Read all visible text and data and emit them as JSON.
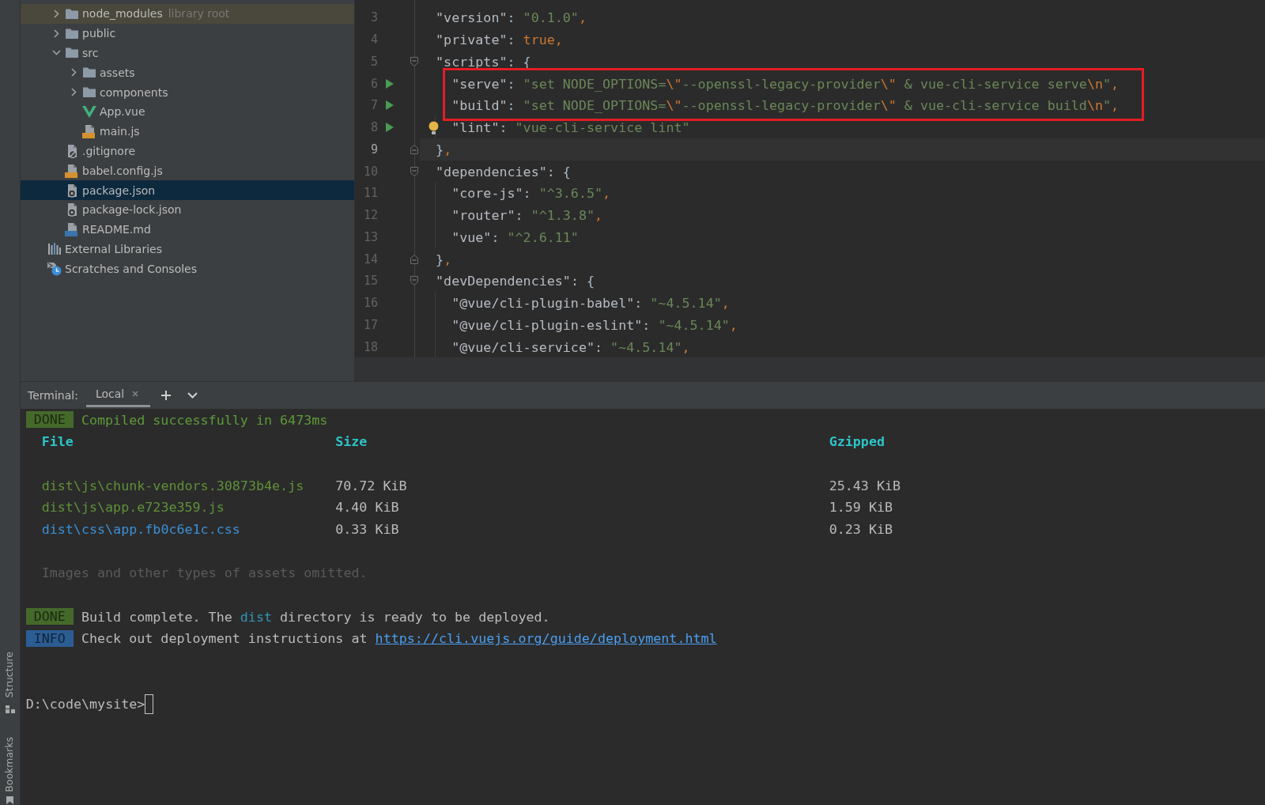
{
  "tool_strip": {
    "items": [
      {
        "kind": "structure",
        "label": "Structure"
      },
      {
        "kind": "bookmarks",
        "label": "Bookmarks"
      }
    ]
  },
  "project_tree": {
    "items": [
      {
        "kind": "folder",
        "label": "node_modules",
        "hint": "library root",
        "expanded": false,
        "selected": false,
        "library": true
      },
      {
        "kind": "folder",
        "label": "public",
        "expanded": false,
        "selected": false,
        "library": false
      },
      {
        "kind": "folder",
        "label": "src",
        "expanded": true,
        "selected": false,
        "library": false,
        "children": [
          {
            "kind": "folder",
            "label": "assets",
            "expanded": false,
            "selected": false,
            "library": false
          },
          {
            "kind": "folder",
            "label": "components",
            "expanded": false,
            "selected": false,
            "library": false
          },
          {
            "kind": "vue",
            "label": "App.vue",
            "selected": false,
            "library": false
          },
          {
            "kind": "js",
            "label": "main.js",
            "selected": false,
            "library": false
          }
        ]
      },
      {
        "kind": "ignore",
        "label": ".gitignore",
        "selected": false,
        "library": false
      },
      {
        "kind": "js",
        "label": "babel.config.js",
        "selected": false,
        "library": false
      },
      {
        "kind": "json",
        "label": "package.json",
        "selected": true,
        "library": false
      },
      {
        "kind": "json",
        "label": "package-lock.json",
        "selected": false,
        "library": false
      },
      {
        "kind": "markdown",
        "label": "README.md",
        "selected": false,
        "library": false
      }
    ],
    "top_items": [
      {
        "kind": "libraries",
        "label": "External Libraries",
        "selected": false
      },
      {
        "kind": "scratches",
        "label": "Scratches and Consoles",
        "selected": false
      }
    ]
  },
  "editor": {
    "lines": [
      {
        "number": "3",
        "text": "  \"version\": \"0.1.0\",",
        "current": false,
        "boxed": false,
        "runnable": false,
        "bulb": false,
        "fold_start": false,
        "fold_end": false
      },
      {
        "number": "4",
        "text": "  \"private\": true,",
        "current": false,
        "boxed": false,
        "runnable": false,
        "bulb": false,
        "fold_start": false,
        "fold_end": false
      },
      {
        "number": "5",
        "text": "  \"scripts\": {",
        "current": false,
        "boxed": false,
        "runnable": false,
        "bulb": false,
        "fold_start": true,
        "fold_end": false
      },
      {
        "number": "6",
        "text": "    \"serve\": \"set NODE_OPTIONS=\\\"--openssl-legacy-provider\\\" & vue-cli-service serve\\n\",",
        "current": false,
        "boxed": true,
        "runnable": true,
        "bulb": false,
        "fold_start": false,
        "fold_end": false
      },
      {
        "number": "7",
        "text": "    \"build\": \"set NODE_OPTIONS=\\\"--openssl-legacy-provider\\\" & vue-cli-service build\\n\",",
        "current": false,
        "boxed": true,
        "runnable": true,
        "bulb": false,
        "fold_start": false,
        "fold_end": false
      },
      {
        "number": "8",
        "text": "    \"lint\": \"vue-cli-service lint\"",
        "current": false,
        "boxed": false,
        "runnable": true,
        "bulb": true,
        "fold_start": false,
        "fold_end": false
      },
      {
        "number": "9",
        "text": "  },",
        "current": true,
        "boxed": false,
        "runnable": false,
        "bulb": false,
        "fold_start": false,
        "fold_end": true
      },
      {
        "number": "10",
        "text": "  \"dependencies\": {",
        "current": false,
        "boxed": false,
        "runnable": false,
        "bulb": false,
        "fold_start": true,
        "fold_end": false
      },
      {
        "number": "11",
        "text": "    \"core-js\": \"^3.6.5\",",
        "current": false,
        "boxed": false,
        "runnable": false,
        "bulb": false,
        "fold_start": false,
        "fold_end": false
      },
      {
        "number": "12",
        "text": "    \"router\": \"^1.3.8\",",
        "current": false,
        "boxed": false,
        "runnable": false,
        "bulb": false,
        "fold_start": false,
        "fold_end": false
      },
      {
        "number": "13",
        "text": "    \"vue\": \"^2.6.11\"",
        "current": false,
        "boxed": false,
        "runnable": false,
        "bulb": false,
        "fold_start": false,
        "fold_end": false
      },
      {
        "number": "14",
        "text": "  },",
        "current": false,
        "boxed": false,
        "runnable": false,
        "bulb": false,
        "fold_start": false,
        "fold_end": true
      },
      {
        "number": "15",
        "text": "  \"devDependencies\": {",
        "current": false,
        "boxed": false,
        "runnable": false,
        "bulb": false,
        "fold_start": true,
        "fold_end": false
      },
      {
        "number": "16",
        "text": "    \"@vue/cli-plugin-babel\": \"~4.5.14\",",
        "current": false,
        "boxed": false,
        "runnable": false,
        "bulb": false,
        "fold_start": false,
        "fold_end": false
      },
      {
        "number": "17",
        "text": "    \"@vue/cli-plugin-eslint\": \"~4.5.14\",",
        "current": false,
        "boxed": false,
        "runnable": false,
        "bulb": false,
        "fold_start": false,
        "fold_end": false
      },
      {
        "number": "18",
        "text": "    \"@vue/cli-service\": \"~4.5.14\",",
        "current": false,
        "boxed": false,
        "runnable": false,
        "bulb": false,
        "fold_start": false,
        "fold_end": false
      }
    ]
  },
  "terminal": {
    "title": "Terminal:",
    "tabs": [
      {
        "label": "Local",
        "selected": true
      }
    ],
    "output": [
      {
        "kind": "status",
        "badge": {
          "label": "DONE",
          "color": "#45692b"
        },
        "parts": [
          {
            "kind": "success",
            "text": "Compiled successfully in 6473ms"
          }
        ]
      },
      {
        "kind": "table",
        "columns": [
          "File",
          "Size",
          "Gzipped"
        ],
        "rows": [
          {
            "file": "dist\\js\\chunk-vendors.30873b4e.js",
            "color": "#5f9138",
            "size": "70.72 KiB",
            "gzipped": "25.43 KiB"
          },
          {
            "file": "dist\\js\\app.e723e359.js",
            "color": "#5f9138",
            "size": "4.40 KiB",
            "gzipped": "1.59 KiB"
          },
          {
            "file": "dist\\css\\app.fb0c6e1c.css",
            "color": "#3b8fd6",
            "size": "0.33 KiB",
            "gzipped": "0.23 KiB"
          }
        ]
      },
      {
        "kind": "blank"
      },
      {
        "kind": "note",
        "text": "Images and other types of assets omitted."
      },
      {
        "kind": "blank"
      },
      {
        "kind": "status",
        "badge": {
          "label": "DONE",
          "color": "#45692b"
        },
        "parts": [
          {
            "kind": "plain",
            "text": "Build complete. The "
          },
          {
            "kind": "code",
            "text": "dist"
          },
          {
            "kind": "plain",
            "text": " directory is ready to be deployed."
          }
        ]
      },
      {
        "kind": "status",
        "badge": {
          "label": "INFO",
          "color": "#2b5d93"
        },
        "parts": [
          {
            "kind": "plain",
            "text": "Check out deployment instructions at "
          },
          {
            "kind": "link",
            "text": "https://cli.vuejs.org/guide/deployment.html"
          }
        ]
      },
      {
        "kind": "blank"
      },
      {
        "kind": "blank"
      },
      {
        "kind": "prompt",
        "text": "D:\\code\\mysite>"
      }
    ]
  }
}
